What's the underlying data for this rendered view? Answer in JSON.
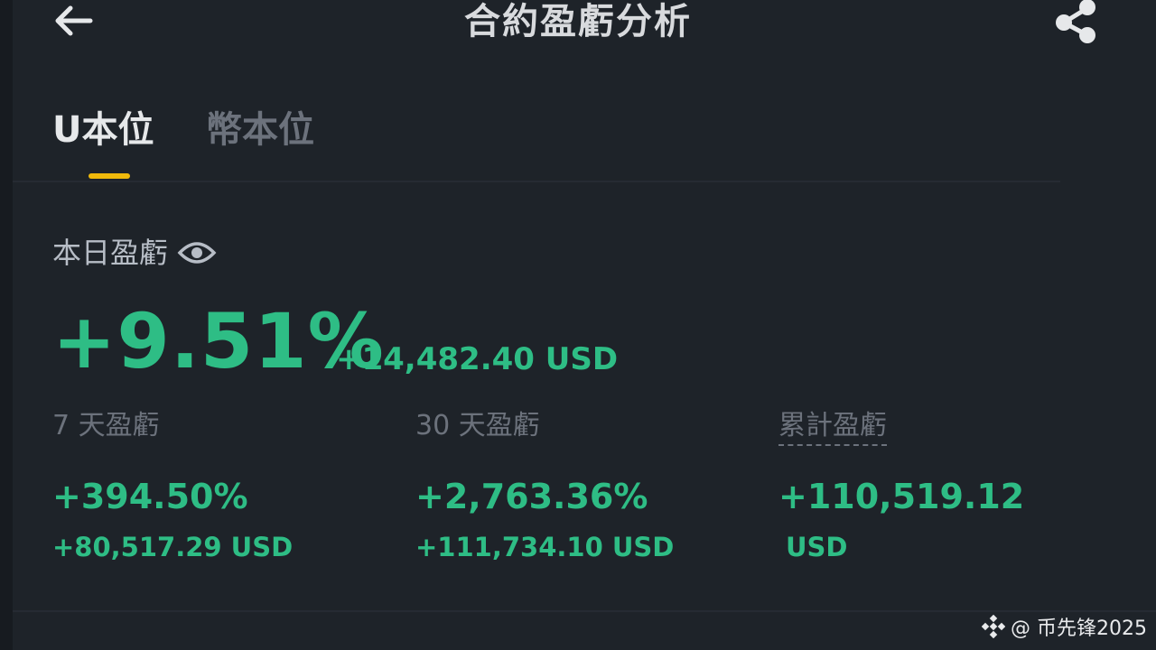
{
  "header": {
    "title": "合約盈虧分析",
    "back_icon": "arrow-left-icon",
    "share_icon": "share-icon"
  },
  "tabs": [
    {
      "label": "U本位",
      "active": true
    },
    {
      "label": "幣本位",
      "active": false
    }
  ],
  "today": {
    "label": "本日盈虧",
    "icon": "eye-icon",
    "percent": "+9.51%",
    "usd": "+14,482.40 USD"
  },
  "stats": [
    {
      "label": "7 天盈虧",
      "percent": "+394.50%",
      "usd": "+80,517.29 USD"
    },
    {
      "label": "30 天盈虧",
      "percent": "+2,763.36%",
      "usd": "+111,734.10 USD"
    },
    {
      "label": "累計盈虧",
      "percent": "+110,519.12",
      "usd": "USD"
    }
  ],
  "watermark": "@ 币先锋2025",
  "colors": {
    "background": "#1e2329",
    "positive": "#2ebd85",
    "accent": "#f0b90b",
    "muted": "#6c727c"
  }
}
